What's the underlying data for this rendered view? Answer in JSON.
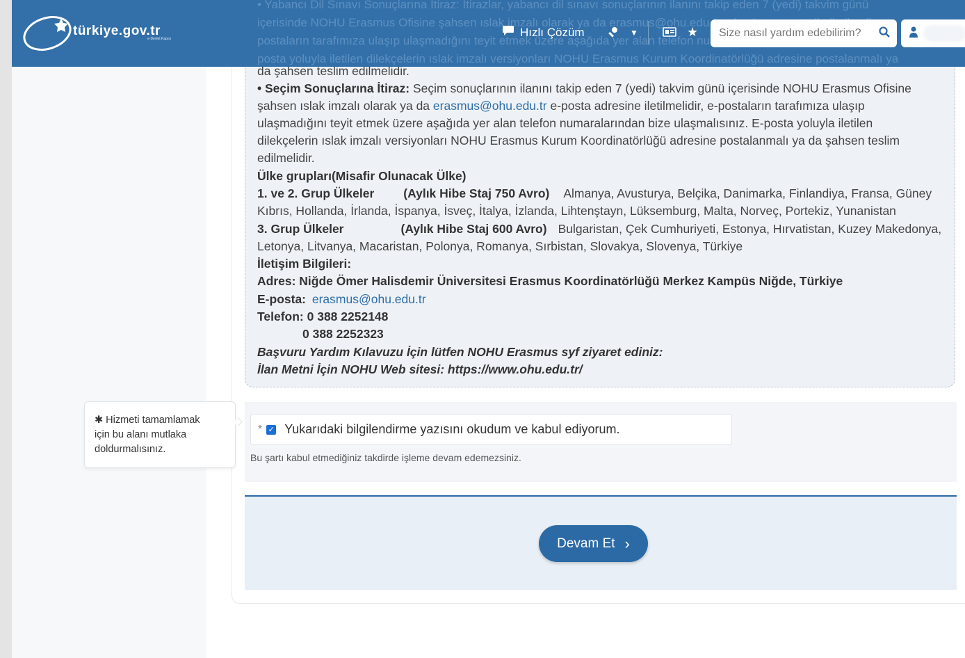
{
  "header": {
    "logo_text": "türkiye.gov.tr",
    "logo_sub": "e-Devlet Kapısı",
    "quick_solution": "Hızlı Çözüm",
    "search_placeholder": "Size nasıl yardım edebilirim?",
    "ghost_lines": [
      "• Yabancı Dil Sınavı Sonuçlarına İtiraz: İtirazlar, yabancı dil sınavı sonuçlarının ilanını takip eden 7 (yedi) takvim günü",
      "içerisinde NOHU Erasmus Ofisine şahsen ıslak imzalı olarak ya da erasmus@ohu.edu.tr adresine e-posta ile iletilmeli,",
      "postaların tarafımıza ulaşıp ulaşmadığını teyit etmek üzere aşağıda yer alan telefon numaralarından bize ulaşmalısınız.",
      "posta yoluyla iletilen dilekçelerin ıslak imzalı versiyonları NOHU Erasmus Kurum Koordinatörlüğü adresine postalanmalı ya"
    ]
  },
  "info": {
    "line0": "da şahsen teslim edilmelidir.",
    "itiraz_title": "• Seçim Sonuçlarına İtiraz:",
    "itiraz_text1": " Seçim sonuçlarının ilanını takip eden 7 (yedi) takvim günü içerisinde NOHU Erasmus Ofisine",
    "itiraz_text2a": "şahsen ıslak imzalı olarak ya da ",
    "email": "erasmus@ohu.edu.tr",
    "itiraz_text2b": " e-posta adresine iletilmelidir, e-postaların tarafımıza ulaşıp",
    "itiraz_text3": "ulaşmadığını teyit etmek üzere aşağıda yer alan telefon numaralarından bize ulaşmalısınız. E-posta yoluyla iletilen",
    "itiraz_text4": "dilekçelerin ıslak imzalı versiyonları NOHU  Erasmus Kurum Koordinatörlüğü adresine postalanmalı ya da şahsen teslim",
    "itiraz_text5": "edilmelidir.",
    "groups_title": "Ülke grupları(Misafir Olunacak Ülke)",
    "group1_name": "1. ve 2. Grup Ülkeler",
    "group1_grant": "(Aylık Hibe Staj 750 Avro)",
    "group1_countries1": "Almanya, Avusturya, Belçika, Danimarka, Finlandiya, Fransa, Güney",
    "group1_countries2": "Kıbrıs, Hollanda, İrlanda, İspanya, İsveç, İtalya, İzlanda, Lihtenştayn, Lüksemburg, Malta, Norveç, Portekiz, Yunanistan",
    "group3_name": "3. Grup Ülkeler",
    "group3_grant": "(Aylık Hibe Staj 600 Avro)",
    "group3_countries1": "Bulgaristan, Çek Cumhuriyeti, Estonya, Hırvatistan, Kuzey Makedonya,",
    "group3_countries2": "Letonya, Litvanya, Macaristan, Polonya, Romanya, Sırbistan, Slovakya, Slovenya, Türkiye",
    "contact_title": "İletişim Bilgileri:",
    "address": "Adres: Niğde Ömer Halisdemir Üniversitesi Erasmus Koordinatörlüğü Merkez Kampüs Niğde, Türkiye",
    "email_label": "E-posta:",
    "phone_label": "Telefon: 0 388 2252148",
    "phone2": "0 388 2252323",
    "guide": "Başvuru Yardım Kılavuzu İçin lütfen NOHU Erasmus syf ziyaret ediniz:",
    "web_label": "İlan Metni İçin NOHU Web sitesi: ",
    "web_url": "https://www.ohu.edu.tr/"
  },
  "tooltip": {
    "line1": "✱ Hizmeti tamamlamak",
    "line2": "için bu alanı mutlaka",
    "line3": "doldurmalısınız."
  },
  "agreement": {
    "required_mark": "*",
    "label": "Yukarıdaki bilgilendirme yazısını okudum ve kabul ediyorum.",
    "warning": "Bu şartı kabul etmediğiniz takdirde işleme devam edemezsiniz.",
    "checked": true
  },
  "action": {
    "continue_label": "Devam Et"
  },
  "colors": {
    "header": "#2b6aa5",
    "accent": "#2b6aa5",
    "checkbox": "#1a6fd4"
  }
}
